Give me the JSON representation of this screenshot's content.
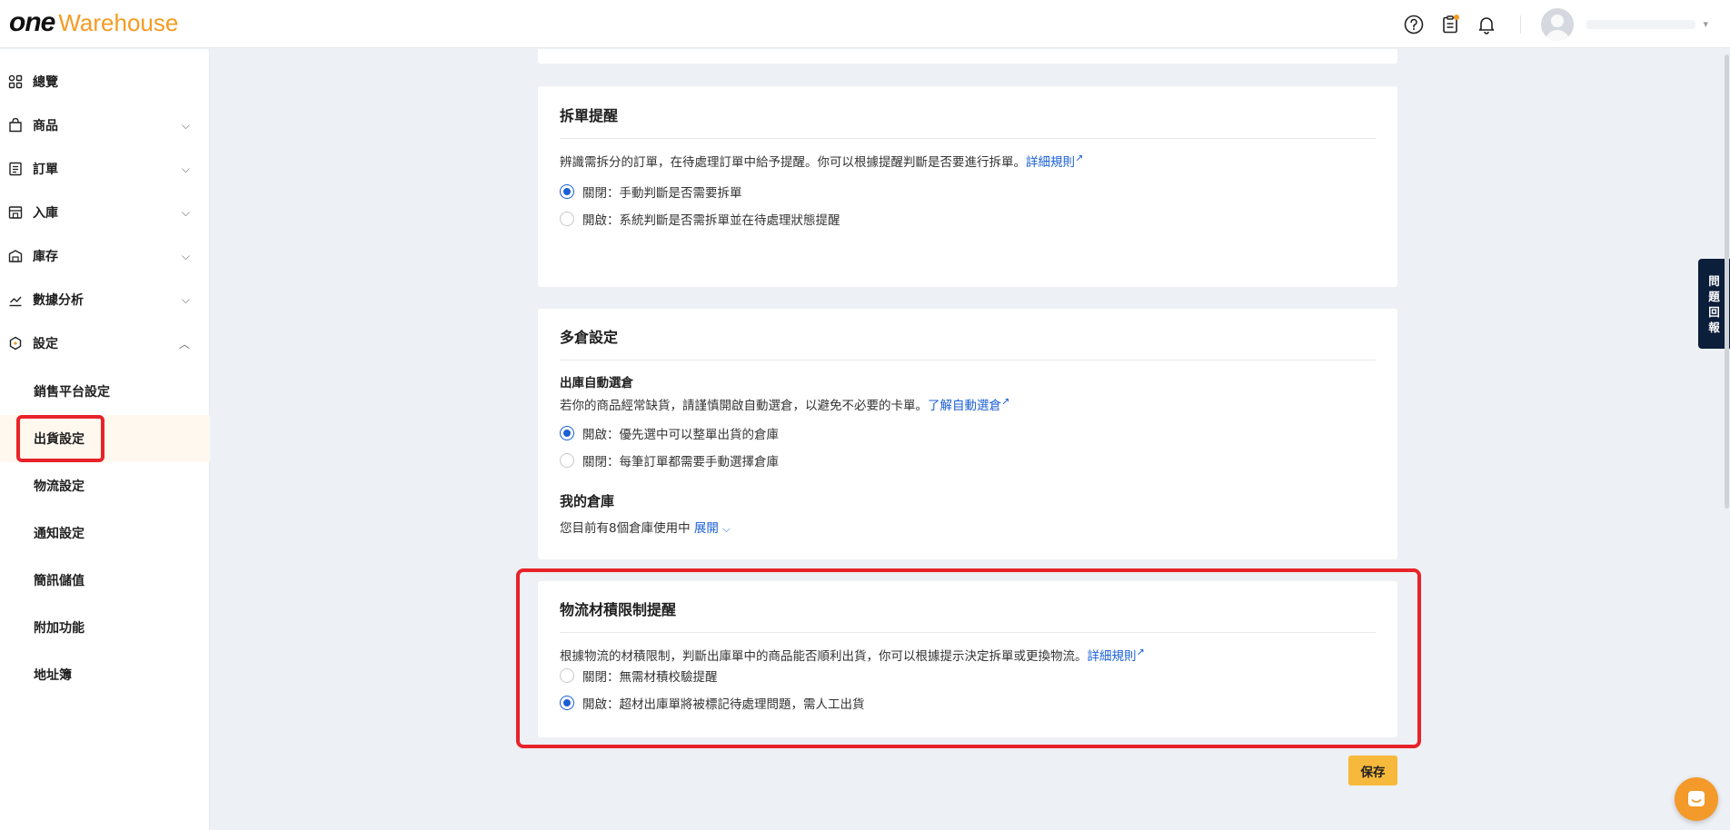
{
  "header": {
    "logo_one": "one",
    "logo_warehouse": "Warehouse"
  },
  "sidebar": {
    "items": [
      {
        "label": "總覽"
      },
      {
        "label": "商品"
      },
      {
        "label": "訂單"
      },
      {
        "label": "入庫"
      },
      {
        "label": "庫存"
      },
      {
        "label": "數據分析"
      },
      {
        "label": "設定"
      }
    ],
    "sub_items": [
      {
        "label": "銷售平台設定"
      },
      {
        "label": "出貨設定"
      },
      {
        "label": "物流設定"
      },
      {
        "label": "通知設定"
      },
      {
        "label": "簡訊儲值"
      },
      {
        "label": "附加功能"
      },
      {
        "label": "地址簿"
      }
    ]
  },
  "split_card": {
    "title": "拆單提醒",
    "desc": "辨識需拆分的訂單，在待處理訂單中給予提醒。你可以根據提醒判斷是否要進行拆單。",
    "link": "詳細規則",
    "option_off": "關閉：手動判斷是否需要拆單",
    "option_on": "開啟：系統判斷是否需拆單並在待處理狀態提醒"
  },
  "multi_card": {
    "title": "多倉設定",
    "auto_heading": "出庫自動選倉",
    "auto_desc": "若你的商品經常缺貨，請謹慎開啟自動選倉，以避免不必要的卡單。",
    "auto_link": "了解自動選倉",
    "option_on": "開啟：優先選中可以整單出貨的倉庫",
    "option_off": "關閉：每筆訂單都需要手動選擇倉庫",
    "my_wh_heading": "我的倉庫",
    "my_wh_desc": "您目前有8個倉庫使用中",
    "expand_link": "展開"
  },
  "volume_card": {
    "title": "物流材積限制提醒",
    "desc": "根據物流的材積限制，判斷出庫單中的商品能否順利出貨，你可以根據提示決定拆單或更換物流。",
    "link": "詳細規則",
    "option_off": "關閉：無需材積校驗提醒",
    "option_on": "開啟：超材出庫單將被標記待處理問題，需人工出貨"
  },
  "save_label": "保存",
  "feedback_chars": [
    "問",
    "題",
    "回",
    "報"
  ],
  "colors": {
    "accent": "#1a5fd7",
    "brand_orange": "#f59b22",
    "save_yellow": "#f6b93b",
    "highlight_red": "#e8232a"
  }
}
